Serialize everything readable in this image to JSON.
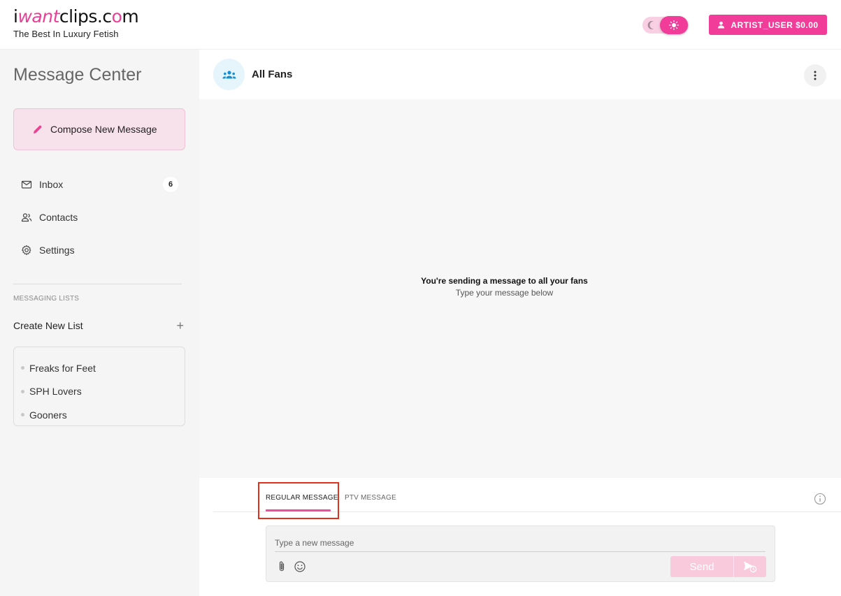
{
  "header": {
    "logo": {
      "part1": "i",
      "part2": "want",
      "part3": "clips.c",
      "part4": "o",
      "part5": "m"
    },
    "tagline": "The Best In Luxury Fetish",
    "user_button_label": "ARTIST_USER $0.00",
    "theme": "light"
  },
  "sidebar": {
    "title": "Message Center",
    "compose_label": "Compose New Message",
    "nav": [
      {
        "label": "Inbox",
        "icon": "mail-icon",
        "badge": "6"
      },
      {
        "label": "Contacts",
        "icon": "contacts-icon"
      },
      {
        "label": "Settings",
        "icon": "gear-icon"
      }
    ],
    "lists_section_label": "MESSAGING LISTS",
    "create_list_label": "Create New List",
    "lists": [
      "Freaks for Feet",
      "SPH Lovers",
      "Gooners"
    ]
  },
  "chat": {
    "title": "All Fans",
    "empty_title": "You're sending a message to all your fans",
    "empty_subtitle": "Type your message below"
  },
  "tabs": {
    "regular": "REGULAR MESSAGE",
    "ptv": "PTV MESSAGE",
    "active": "regular"
  },
  "composer": {
    "placeholder": "Type a new message",
    "send_label": "Send"
  },
  "colors": {
    "brand": "#f23c99",
    "highlight": "#e0301e",
    "send_disabled": "#f8cadb"
  }
}
